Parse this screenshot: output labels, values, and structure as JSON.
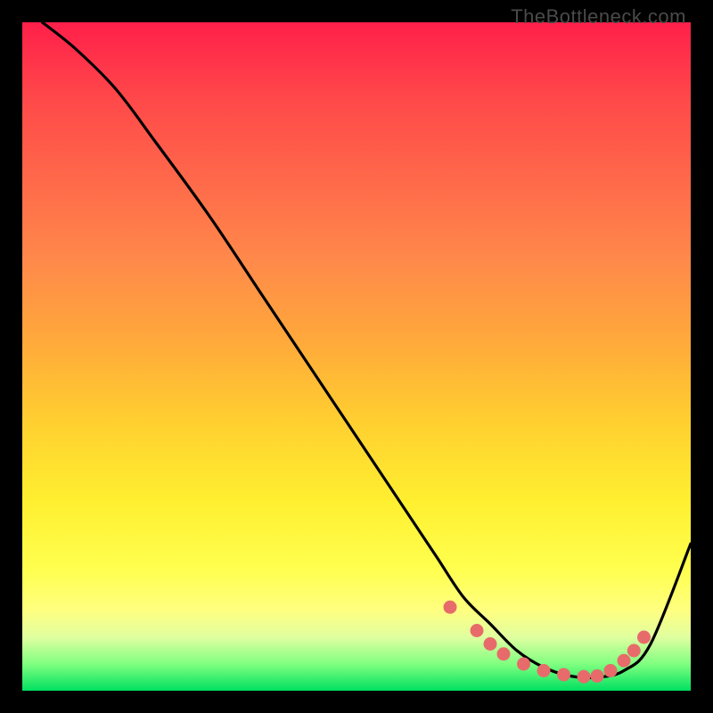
{
  "watermark": "TheBottleneck.com",
  "chart_data": {
    "type": "line",
    "title": "",
    "xlabel": "",
    "ylabel": "",
    "xlim": [
      0,
      100
    ],
    "ylim": [
      0,
      100
    ],
    "series": [
      {
        "name": "curve",
        "x": [
          3,
          8,
          14,
          20,
          28,
          36,
          44,
          52,
          58,
          62,
          66,
          70,
          74,
          78,
          82,
          86,
          90,
          94,
          100
        ],
        "y": [
          100,
          96,
          90,
          82,
          71,
          59,
          47,
          35,
          26,
          20,
          14,
          10,
          6,
          3.5,
          2.2,
          2,
          3,
          7,
          22
        ]
      }
    ],
    "markers": {
      "name": "dots",
      "color": "#e86b6b",
      "points": [
        {
          "x": 64,
          "y": 12.5
        },
        {
          "x": 68,
          "y": 9
        },
        {
          "x": 70,
          "y": 7
        },
        {
          "x": 72,
          "y": 5.5
        },
        {
          "x": 75,
          "y": 4
        },
        {
          "x": 78,
          "y": 3
        },
        {
          "x": 81,
          "y": 2.4
        },
        {
          "x": 84,
          "y": 2.1
        },
        {
          "x": 86,
          "y": 2.2
        },
        {
          "x": 88,
          "y": 3
        },
        {
          "x": 90,
          "y": 4.5
        },
        {
          "x": 91.5,
          "y": 6
        },
        {
          "x": 93,
          "y": 8
        }
      ]
    }
  }
}
